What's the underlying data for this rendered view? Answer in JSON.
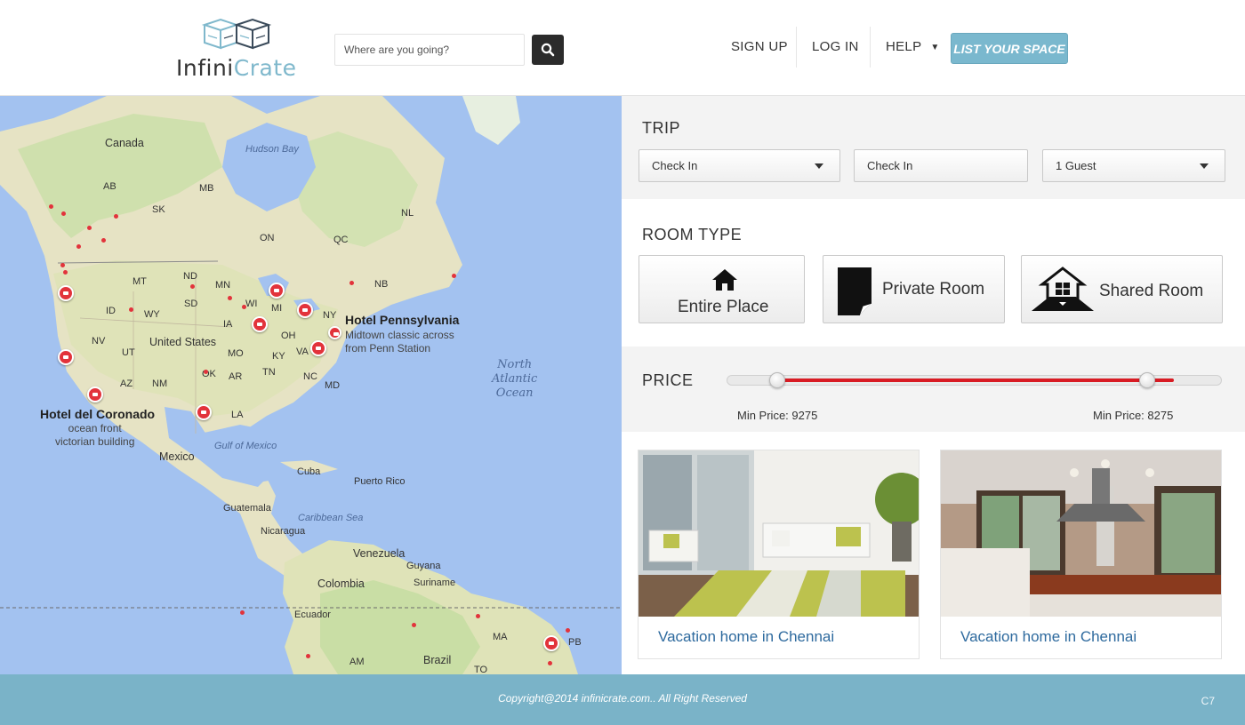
{
  "brand": {
    "logo_part1": "Infini",
    "logo_part2": "Crate"
  },
  "search": {
    "placeholder": "Where are you going?"
  },
  "nav": {
    "signup": "SIGN UP",
    "login": "LOG IN",
    "help": "HELP",
    "list_space": "LIST YOUR SPACE"
  },
  "map": {
    "labels": {
      "canada": "Canada",
      "hudson_bay": "Hudson Bay",
      "ab": "AB",
      "mb": "MB",
      "sk": "SK",
      "on": "ON",
      "qc": "QC",
      "nl": "NL",
      "nb": "NB",
      "mt": "MT",
      "nd": "ND",
      "mn": "MN",
      "wi": "WI",
      "mi": "MI",
      "ny": "NY",
      "id": "ID",
      "wy": "WY",
      "sd": "SD",
      "ia": "IA",
      "oh": "OH",
      "nv": "NV",
      "ut": "UT",
      "mo": "MO",
      "ky": "KY",
      "va": "VA",
      "az": "AZ",
      "nm": "NM",
      "ok": "OK",
      "ar": "AR",
      "tn": "TN",
      "nc": "NC",
      "md": "MD",
      "la": "LA",
      "united_states": "United States",
      "gulf": "Gulf of Mexico",
      "mexico": "Mexico",
      "cuba": "Cuba",
      "puerto_rico": "Puerto Rico",
      "guatemala": "Guatemala",
      "caribbean": "Caribbean Sea",
      "nicaragua": "Nicaragua",
      "venezuela": "Venezuela",
      "guyana": "Guyana",
      "suriname": "Suriname",
      "colombia": "Colombia",
      "ecuador": "Ecuador",
      "brazil": "Brazil",
      "ma": "MA",
      "pb": "PB",
      "am": "AM",
      "to": "TO",
      "ocean_line1": "North",
      "ocean_line2": "Atlantic",
      "ocean_line3": "Ocean"
    },
    "hotels": [
      {
        "name": "Hotel Pennsylvania",
        "line1": "Midtown classic across",
        "line2": "from Penn Station"
      },
      {
        "name": "Hotel del Coronado",
        "line1": "ocean front",
        "line2": "victorian building"
      }
    ]
  },
  "trip": {
    "title": "TRIP",
    "checkin": "Check In",
    "checkout": "Check In",
    "guests": "1 Guest"
  },
  "room_type": {
    "title": "ROOM TYPE",
    "options": [
      "Entire Place",
      "Private Room",
      "Shared Room"
    ]
  },
  "price": {
    "title": "PRICE",
    "min_label": "Min Price: 9275",
    "max_label": "Min Price: 8275",
    "range_low_fraction": 0.1,
    "range_high_fraction": 0.85
  },
  "listings": [
    {
      "title": "Vacation home in Chennai"
    },
    {
      "title": "Vacation home in Chennai"
    }
  ],
  "footer": {
    "copyright": "Copyright@2014 infinicrate.com.. All Right Reserved",
    "code": "C7"
  },
  "colors": {
    "accent": "#7ab8ce",
    "footer": "#7ab3c8",
    "pin": "#e2333b",
    "slider_fill": "#d81b23",
    "link": "#2e6a9e"
  }
}
